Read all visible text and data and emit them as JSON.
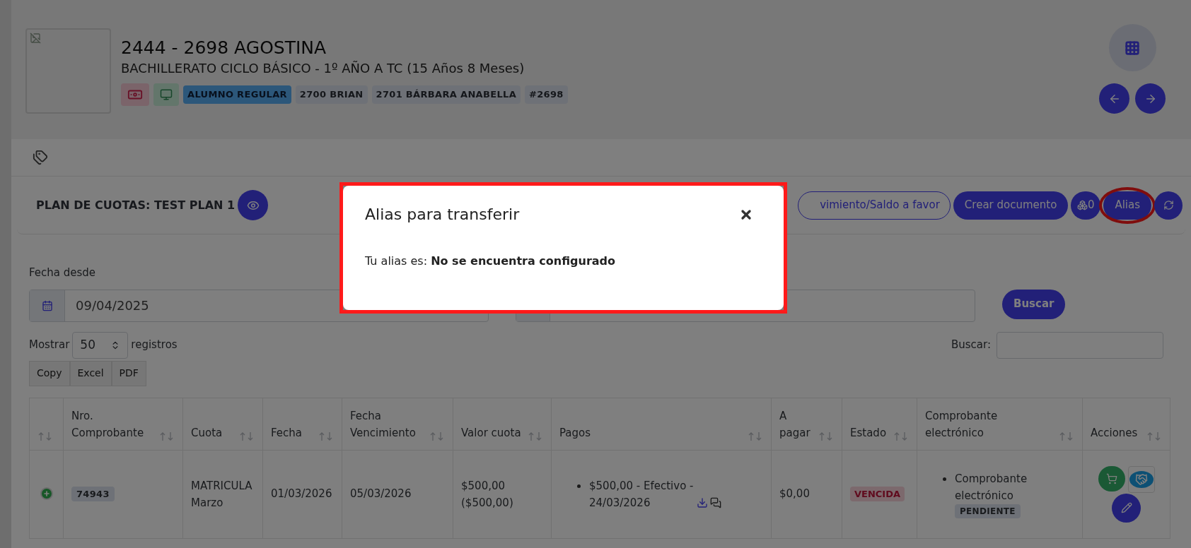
{
  "student": {
    "title": "2444 - 2698 AGOSTINA",
    "subtitle": "BACHILLERATO CICLO BÁSICO - 1º AÑO A TC (15 Años 8 Meses)",
    "badges": [
      {
        "kind": "money"
      },
      {
        "kind": "monitor"
      },
      {
        "kind": "primary",
        "text": "ALUMNO REGULAR"
      },
      {
        "kind": "secondary",
        "text": "2700 BRIAN"
      },
      {
        "kind": "secondary",
        "text": "2701 BÁRBARA ANABELLA"
      },
      {
        "kind": "secondary",
        "text": "#2698"
      }
    ]
  },
  "plan": {
    "title": "PLAN DE CUOTAS: TEST PLAN 1",
    "buttons": [
      {
        "kind": "outline",
        "label": "vimiento/Saldo a favor",
        "highlighted": false
      },
      {
        "kind": "solid",
        "label": "Crear documento",
        "highlighted": false
      },
      {
        "kind": "counter",
        "label": "0",
        "highlighted": false
      },
      {
        "kind": "solid",
        "label": "Alias",
        "highlighted": true
      },
      {
        "kind": "refresh",
        "highlighted": false
      }
    ]
  },
  "filters": {
    "from_label": "Fecha desde",
    "from_value": "09/04/2025",
    "search_button": "Buscar"
  },
  "table_controls": {
    "show_label": "Mostrar",
    "page_size": "50",
    "records_label": "registros",
    "search_label": "Buscar:",
    "export_buttons": [
      "Copy",
      "Excel",
      "PDF"
    ]
  },
  "table": {
    "columns": [
      {
        "kind": "blank"
      },
      {
        "kind": "text",
        "label": "Nro. Comprobante"
      },
      {
        "kind": "text",
        "label": "Cuota"
      },
      {
        "kind": "text",
        "label": "Fecha"
      },
      {
        "kind": "text",
        "label": "Fecha Vencimiento"
      },
      {
        "kind": "text",
        "label": "Valor cuota"
      },
      {
        "kind": "text",
        "label": "Pagos"
      },
      {
        "kind": "text",
        "label": "A pagar"
      },
      {
        "kind": "text",
        "label": "Estado"
      },
      {
        "kind": "text",
        "label": "Comprobante electrónico"
      },
      {
        "kind": "text",
        "label": "Acciones"
      }
    ],
    "rows": [
      {
        "number": "74943",
        "cuota": "MATRICULA Marzo",
        "fecha": "01/03/2026",
        "vencimiento": "05/03/2026",
        "valor": "$500,00 ($500,00)",
        "pagos": [
          "$500,00 - Efectivo - 24/03/2026"
        ],
        "a_pagar": "$0,00",
        "estado": {
          "text": "VENCIDA",
          "kind": "danger"
        },
        "comprobante": {
          "text": "Comprobante electrónico",
          "status": "PENDIENTE"
        }
      }
    ]
  },
  "modal": {
    "title": "Alias para transferir",
    "body": "Tu alias es: **No se encuentra configurado**"
  }
}
